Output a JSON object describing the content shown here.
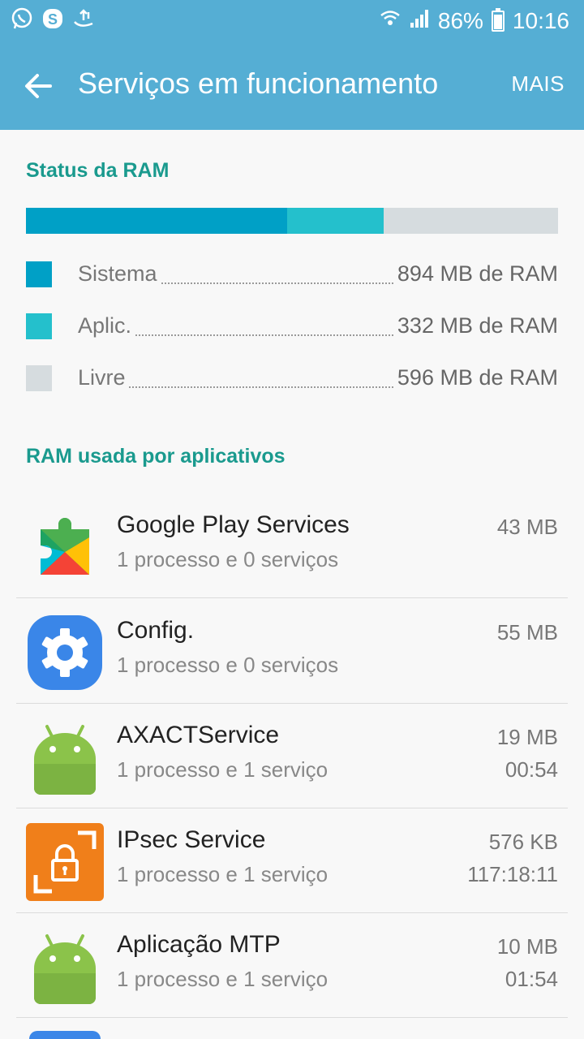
{
  "status_bar": {
    "notification_icons": [
      "whatsapp-icon",
      "skype-icon",
      "usb-transfer-icon"
    ],
    "battery": "86%",
    "time": "10:16"
  },
  "app_bar": {
    "title": "Serviços em funcionamento",
    "more_label": "MAIS"
  },
  "ram_status": {
    "title": "Status da RAM",
    "segments": [
      {
        "label": "Sistema",
        "value": "894 MB de RAM",
        "mb": 894,
        "color": "#00a0c6"
      },
      {
        "label": "Aplic.",
        "value": "332 MB de RAM",
        "mb": 332,
        "color": "#24c0cc"
      },
      {
        "label": "Livre",
        "value": "596 MB de RAM",
        "mb": 596,
        "color": "#d6dcdf"
      }
    ]
  },
  "apps_section": {
    "title": "RAM usada por aplicativos",
    "apps": [
      {
        "name": "Google Play Services",
        "details": "1 processo e 0 serviços",
        "size": "43 MB",
        "time": "",
        "icon": "google-play-services-icon"
      },
      {
        "name": "Config.",
        "details": "1 processo e 0 serviços",
        "size": "55 MB",
        "time": "",
        "icon": "settings-gear-icon"
      },
      {
        "name": "AXACTService",
        "details": "1 processo e 1 serviço",
        "size": "19 MB",
        "time": "00:54",
        "icon": "android-icon"
      },
      {
        "name": "IPsec Service",
        "details": "1 processo e 1 serviço",
        "size": "576 KB",
        "time": "117:18:11",
        "icon": "ipsec-lock-icon"
      },
      {
        "name": "Aplicação MTP",
        "details": "1 processo e 1 serviço",
        "size": "10 MB",
        "time": "01:54",
        "icon": "android-icon"
      }
    ]
  }
}
